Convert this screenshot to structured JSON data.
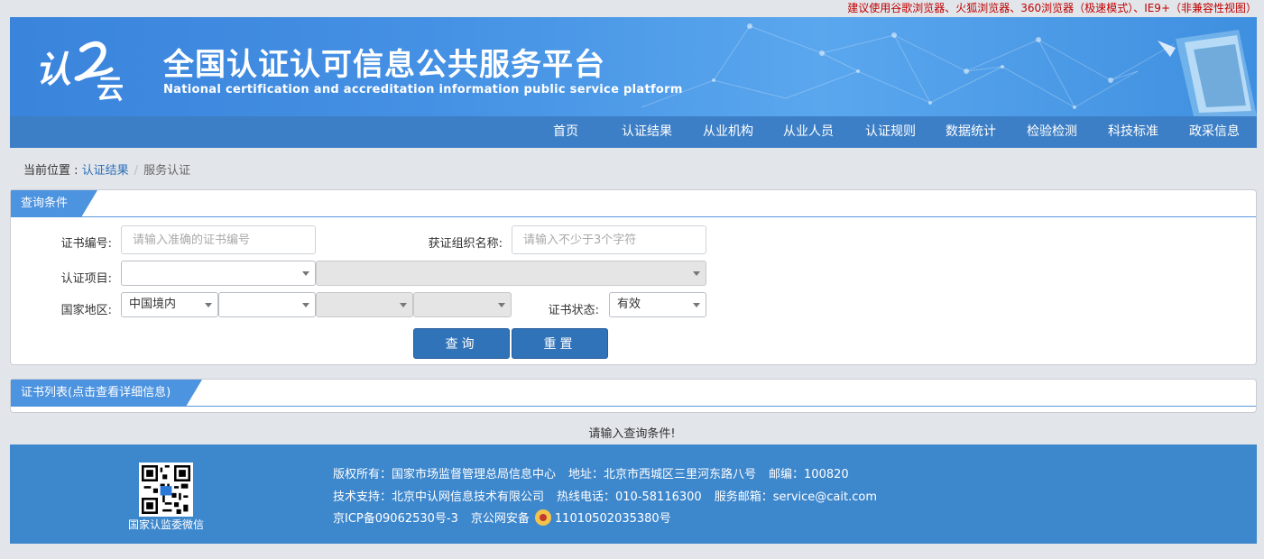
{
  "browser_tip": "建议使用谷歌浏览器、火狐浏览器、360浏览器（极速模式）、IE9+（非兼容性视图）",
  "header": {
    "logo_text": "认云",
    "title": "全国认证认可信息公共服务平台",
    "subtitle": "National certification and accreditation information public service platform"
  },
  "nav": {
    "items": [
      {
        "label": "首页"
      },
      {
        "label": "认证结果"
      },
      {
        "label": "从业机构"
      },
      {
        "label": "从业人员"
      },
      {
        "label": "认证规则"
      },
      {
        "label": "数据统计"
      },
      {
        "label": "检验检测"
      },
      {
        "label": "科技标准"
      },
      {
        "label": "政采信息"
      }
    ]
  },
  "breadcrumb": {
    "prefix": "当前位置 : ",
    "link": "认证结果",
    "separator": "/",
    "current": "服务认证"
  },
  "query": {
    "title": "查询条件",
    "cert_no_label": "证书编号:",
    "cert_no_placeholder": "请输入准确的证书编号",
    "org_label": "获证组织名称:",
    "org_placeholder": "请输入不少于3个字符",
    "project_label": "认证项目:",
    "region_label": "国家地区:",
    "region_value": "中国境内",
    "status_label": "证书状态:",
    "status_value": "有效",
    "search_button": "查询",
    "reset_button": "重置"
  },
  "cert_list": {
    "title": "证书列表(点击查看详细信息)",
    "empty_message": "请输入查询条件!"
  },
  "footer": {
    "qr_caption": "国家认监委微信",
    "copyright": "版权所有：国家市场监督管理总局信息中心",
    "address": "地址：北京市西城区三里河东路八号",
    "postcode": "邮编：100820",
    "tech_support": "技术支持：北京中认网信息技术有限公司",
    "hotline": "热线电话：010-58116300",
    "email": "服务邮箱：service@cait.com",
    "icp": "京ICP备09062530号-3",
    "police_label": "京公网安备",
    "police_no": "11010502035380号"
  },
  "colors": {
    "accent": "#3d7fc6",
    "button": "#3173b9",
    "tip_red": "#c00000"
  }
}
